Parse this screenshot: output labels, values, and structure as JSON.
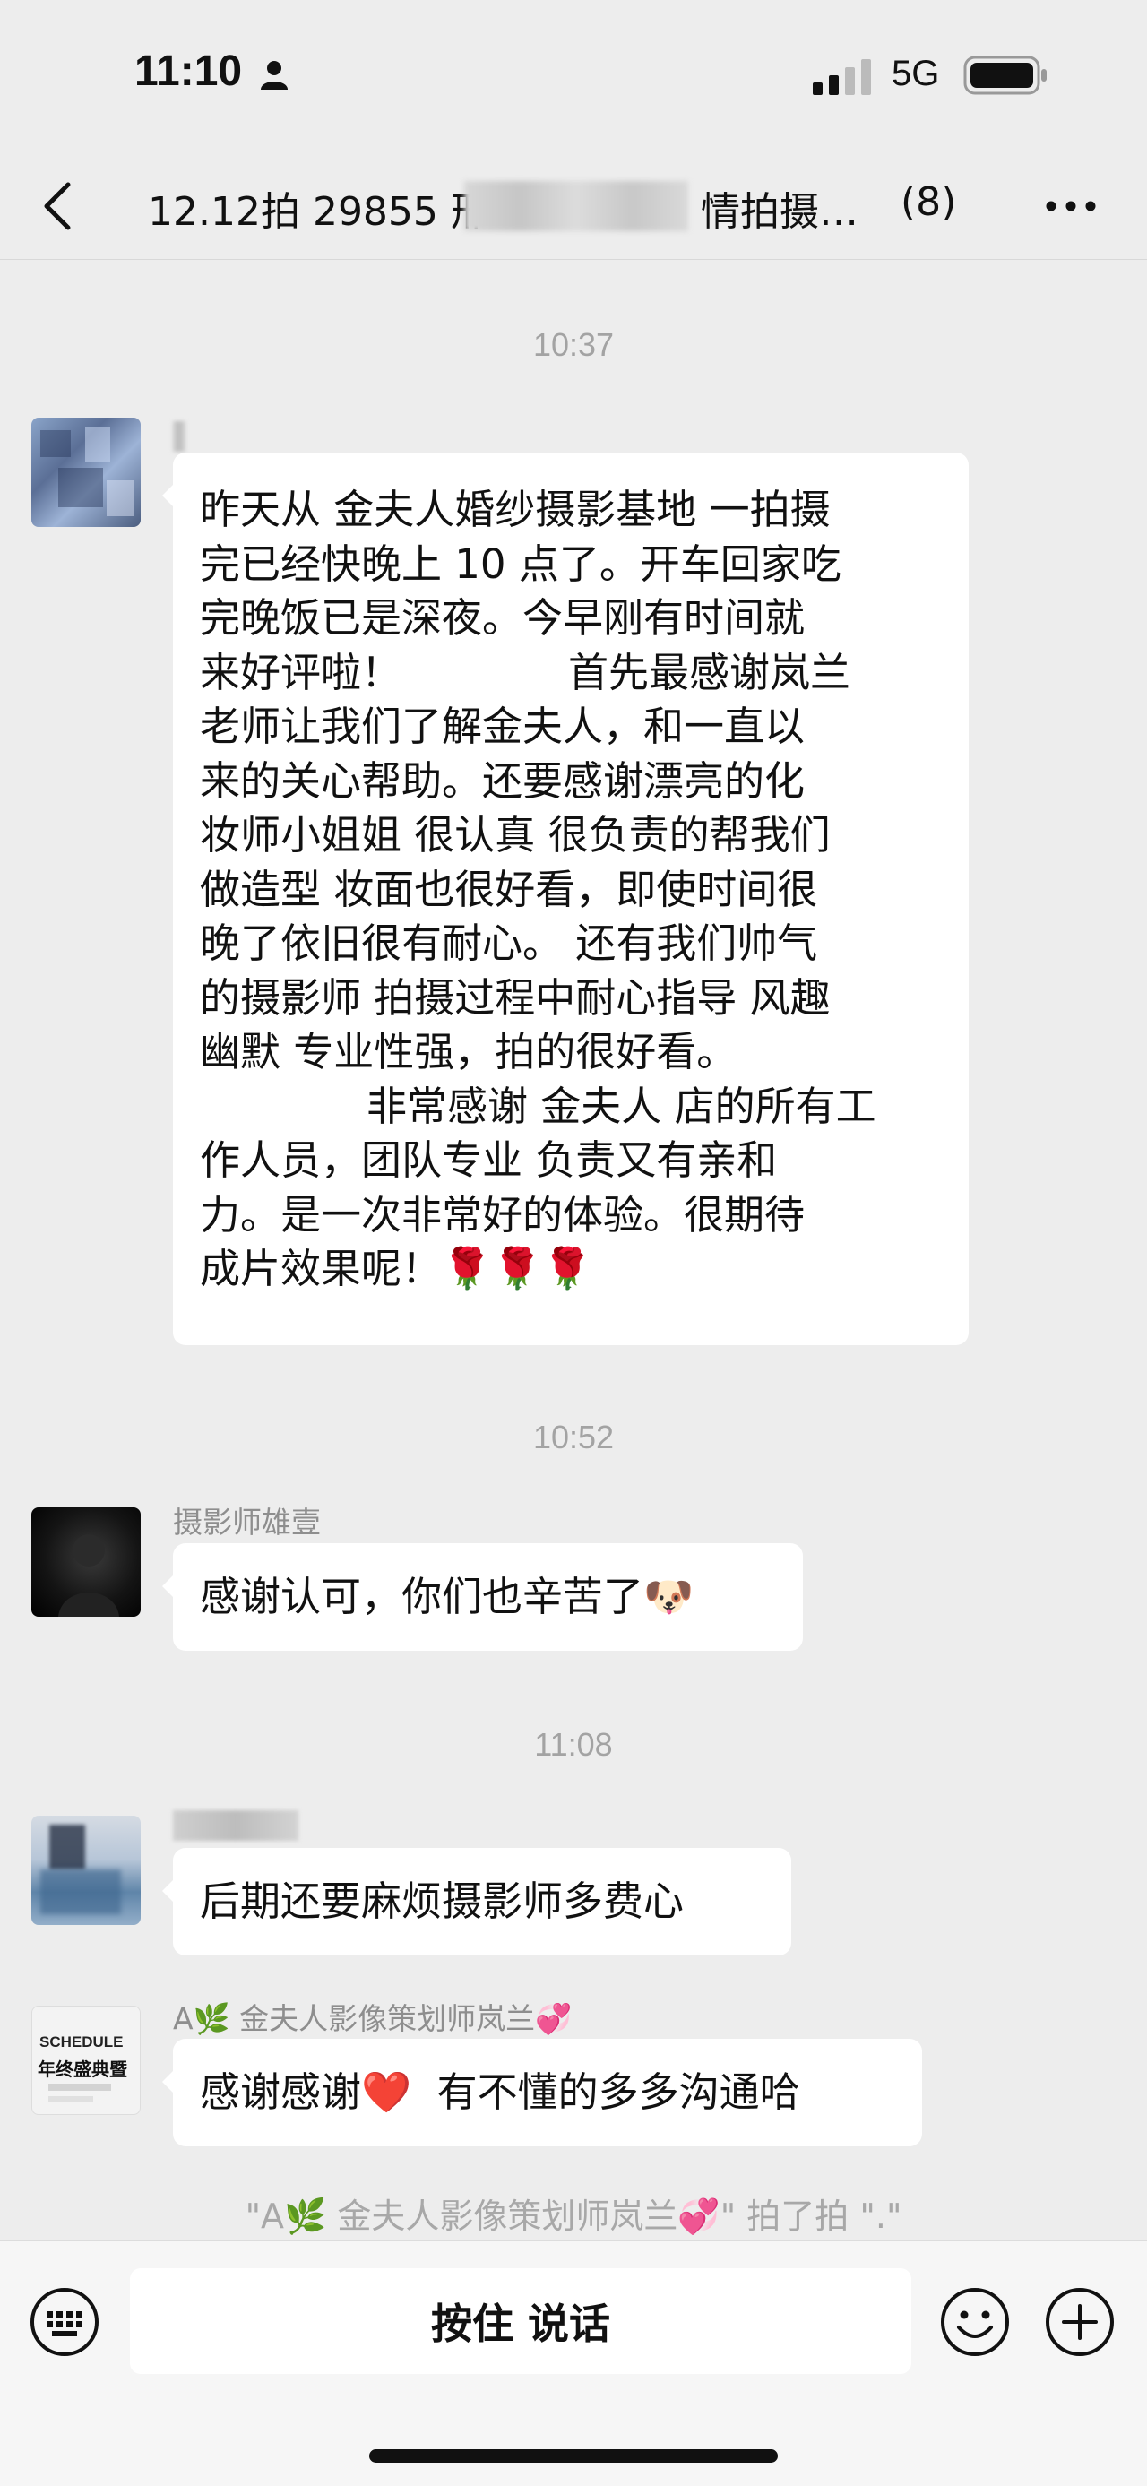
{
  "status_bar": {
    "time": "11:10",
    "network": "5G",
    "icons": [
      "person-icon",
      "signal-icon",
      "battery-icon"
    ]
  },
  "header": {
    "title_prefix": "12.12拍 29855 邢",
    "title_suffix": "情拍摄…",
    "member_count": "(8)"
  },
  "messages": {
    "ts1": "10:37",
    "msg1": {
      "lines": [
        "昨天从 金夫人婚纱摄影基地 一拍摄",
        "完已经快晚上 10 点了。开车回家吃",
        "完晚饭已是深夜。今早刚有时间就",
        "来好评啦！             首先最感谢岚兰",
        "老师让我们了解金夫人，和一直以",
        "来的关心帮助。还要感谢漂亮的化",
        "妆师小姐姐 很认真 很负责的帮我们",
        "做造型 妆面也很好看，即使时间很",
        "晚了依旧很有耐心。 还有我们帅气",
        "的摄影师 拍摄过程中耐心指导 风趣",
        "幽默 专业性强，拍的很好看。",
        "             非常感谢 金夫人 店的所有工",
        "作人员，团队专业 负责又有亲和",
        "力。是一次非常好的体验。很期待",
        "成片效果呢！🌹🌹🌹"
      ]
    },
    "ts2": "10:52",
    "msg2": {
      "sender": "摄影师雄壹",
      "text": "感谢认可，你们也辛苦了🐶"
    },
    "ts3": "11:08",
    "msg3": {
      "text": "后期还要麻烦摄影师多费心"
    },
    "msg4": {
      "sender": "A🌿 金夫人影像策划师岚兰💞",
      "text": "感谢感谢❤️  有不懂的多多沟通哈",
      "avatar_lines": [
        "SCHEDULE",
        "年终盛典暨"
      ]
    },
    "system": "\"A🌿 金夫人影像策划师岚兰💞\" 拍了拍 \".\""
  },
  "input_bar": {
    "hold_to_talk": "按住 说话",
    "icons": [
      "keyboard-icon",
      "emoji-icon",
      "plus-icon"
    ]
  },
  "colors": {
    "background": "#ededed",
    "bubble": "#ffffff",
    "timestamp": "#a3a3a3"
  }
}
